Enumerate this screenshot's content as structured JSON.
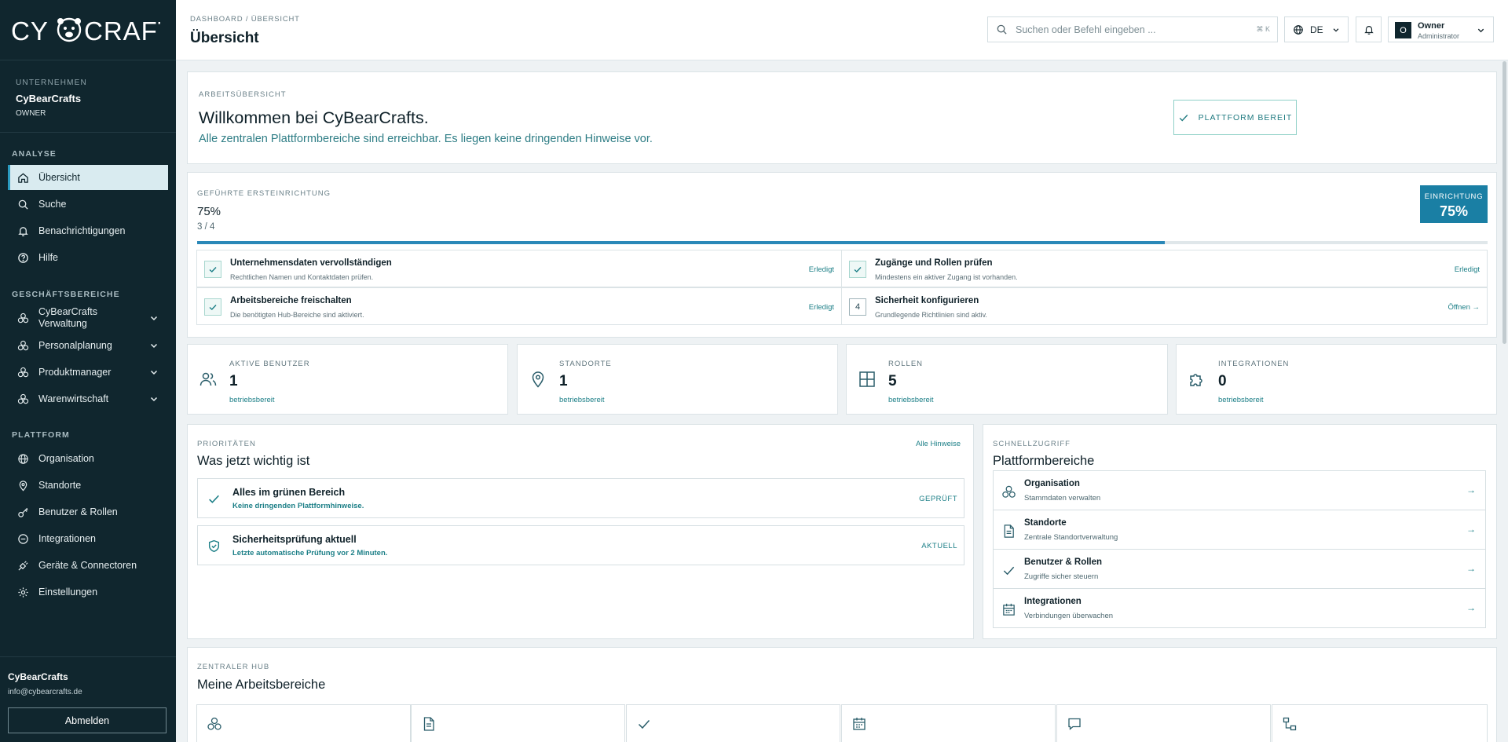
{
  "brand": {
    "logo_text": "CYBEARCRAFTS"
  },
  "sidebar": {
    "company_label": "UNTERNEHMEN",
    "company_name": "CyBearCrafts",
    "company_role": "OWNER",
    "sections": {
      "analyse": "ANALYSE",
      "business": "GESCHÄFTSBEREICHE",
      "platform": "PLATTFORM"
    },
    "analyse_items": [
      {
        "label": "Übersicht",
        "icon": "home-icon",
        "active": true
      },
      {
        "label": "Suche",
        "icon": "search-icon"
      },
      {
        "label": "Benachrichtigungen",
        "icon": "bell-icon"
      },
      {
        "label": "Hilfe",
        "icon": "help-icon"
      }
    ],
    "business_items": [
      {
        "label": "CyBearCrafts Verwaltung",
        "icon": "cubes-icon"
      },
      {
        "label": "Personalplanung",
        "icon": "cubes-icon"
      },
      {
        "label": "Produktmanager",
        "icon": "cubes-icon"
      },
      {
        "label": "Warenwirtschaft",
        "icon": "cubes-icon"
      }
    ],
    "platform_items": [
      {
        "label": "Organisation",
        "icon": "globe-icon"
      },
      {
        "label": "Standorte",
        "icon": "pin-icon"
      },
      {
        "label": "Benutzer & Rollen",
        "icon": "key-icon"
      },
      {
        "label": "Integrationen",
        "icon": "link-icon"
      },
      {
        "label": "Geräte & Connectoren",
        "icon": "plug-icon"
      },
      {
        "label": "Einstellungen",
        "icon": "gear-icon"
      }
    ],
    "user": {
      "name": "CyBearCrafts",
      "email": "info@cybearcrafts.de",
      "logout_label": "Abmelden"
    }
  },
  "header": {
    "breadcrumb": "DASHBOARD / ÜBERSICHT",
    "title": "Übersicht",
    "search_placeholder": "Suchen oder Befehl eingeben ...",
    "search_shortcut": "⌘ K",
    "language": "DE",
    "owner_initial": "O",
    "owner_name": "Owner",
    "owner_role": "Administrator"
  },
  "welcome": {
    "caption": "ARBEITSÜBERSICHT",
    "title": "Willkommen bei CyBearCrafts.",
    "subtitle": "Alle zentralen Plattformbereiche sind erreichbar. Es liegen keine dringenden Hinweise vor.",
    "status_button": "PLATTFORM BEREIT"
  },
  "setup": {
    "caption": "GEFÜHRTE ERSTEINRICHTUNG",
    "percent_text": "75%",
    "count_text": "3 / 4",
    "progress": 0.75,
    "badge_label": "EINRICHTUNG",
    "badge_value": "75%",
    "tasks": [
      {
        "title": "Unternehmensdaten vervollständigen",
        "subtitle": "Rechtlichen Namen und Kontaktdaten prüfen.",
        "status": "Erledigt",
        "done": true
      },
      {
        "title": "Zugänge und Rollen prüfen",
        "subtitle": "Mindestens ein aktiver Zugang ist vorhanden.",
        "status": "Erledigt",
        "done": true
      },
      {
        "title": "Arbeitsbereiche freischalten",
        "subtitle": "Die benötigten Hub-Bereiche sind aktiviert.",
        "status": "Erledigt",
        "done": true
      },
      {
        "title": "Sicherheit konfigurieren",
        "subtitle": "Grundlegende Richtlinien sind aktiv.",
        "status": "Öffnen →",
        "done": false,
        "number": "4"
      }
    ]
  },
  "kpis": [
    {
      "label": "AKTIVE BENUTZER",
      "value": "1",
      "status": "betriebsbereit",
      "icon": "users-icon"
    },
    {
      "label": "STANDORTE",
      "value": "1",
      "status": "betriebsbereit",
      "icon": "pin-icon"
    },
    {
      "label": "ROLLEN",
      "value": "5",
      "status": "betriebsbereit",
      "icon": "grid-icon"
    },
    {
      "label": "INTEGRATIONEN",
      "value": "0",
      "status": "betriebsbereit",
      "icon": "puzzle-icon"
    }
  ],
  "priorities": {
    "caption": "PRIORITÄTEN",
    "title": "Was jetzt wichtig ist",
    "link": "Alle Hinweise",
    "items": [
      {
        "title": "Alles im grünen Bereich",
        "subtitle": "Keine dringenden Plattformhinweise.",
        "status": "GEPRÜFT",
        "icon": "check-icon"
      },
      {
        "title": "Sicherheitsprüfung aktuell",
        "subtitle": "Letzte automatische Prüfung vor 2 Minuten.",
        "status": "AKTUELL",
        "icon": "shield-icon"
      }
    ]
  },
  "quick_access": {
    "caption": "SCHNELLZUGRIFF",
    "title": "Plattformbereiche",
    "items": [
      {
        "title": "Organisation",
        "subtitle": "Stammdaten verwalten",
        "arrow": "→",
        "icon": "cubes-icon"
      },
      {
        "title": "Standorte",
        "subtitle": "Zentrale Standortverwaltung",
        "arrow": "→",
        "icon": "document-icon"
      },
      {
        "title": "Benutzer & Rollen",
        "subtitle": "Zugriffe sicher steuern",
        "arrow": "→",
        "icon": "check-icon"
      },
      {
        "title": "Integrationen",
        "subtitle": "Verbindungen überwachen",
        "arrow": "→",
        "icon": "calendar-icon"
      }
    ]
  },
  "hub": {
    "caption": "ZENTRALER HUB",
    "title": "Meine Arbeitsbereiche",
    "tiles": [
      "cubes-icon",
      "document-icon",
      "check-icon",
      "calendar-icon",
      "chat-icon",
      "workflow-icon"
    ]
  },
  "colors": {
    "sidebar_bg": "#10262e",
    "accent": "#1a7fa4",
    "success_text": "#1c7f87",
    "page_bg": "#eef2f4"
  }
}
